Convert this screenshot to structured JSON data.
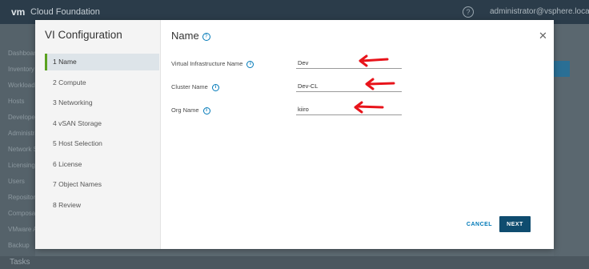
{
  "app": {
    "logo": "vm",
    "name": "Cloud Foundation",
    "user": "administrator@vsphere.local"
  },
  "background": {
    "sidebar": [
      "Dashboard",
      "Inventory",
      "Workload Domains",
      "Hosts",
      "Developer Center",
      "Administration",
      "Network Settings",
      "Licensing",
      "Users",
      "Repository",
      "Composable Infrastructure",
      "VMware Account",
      "Backup"
    ],
    "bottom_bar": "Tasks"
  },
  "modal": {
    "title": "VI Configuration",
    "steps": [
      {
        "label": "1 Name",
        "active": true
      },
      {
        "label": "2 Compute",
        "active": false
      },
      {
        "label": "3 Networking",
        "active": false
      },
      {
        "label": "4 vSAN Storage",
        "active": false
      },
      {
        "label": "5 Host Selection",
        "active": false
      },
      {
        "label": "6 License",
        "active": false
      },
      {
        "label": "7 Object Names",
        "active": false
      },
      {
        "label": "8 Review",
        "active": false
      }
    ],
    "heading": "Name",
    "fields": [
      {
        "label": "Virtual Infrastructure Name",
        "value": "Dev"
      },
      {
        "label": "Cluster Name",
        "value": "Dev-CL"
      },
      {
        "label": "Org Name",
        "value": "kiiro"
      }
    ],
    "cancel_label": "CANCEL",
    "next_label": "NEXT",
    "annotation_color": "#e8141b"
  }
}
